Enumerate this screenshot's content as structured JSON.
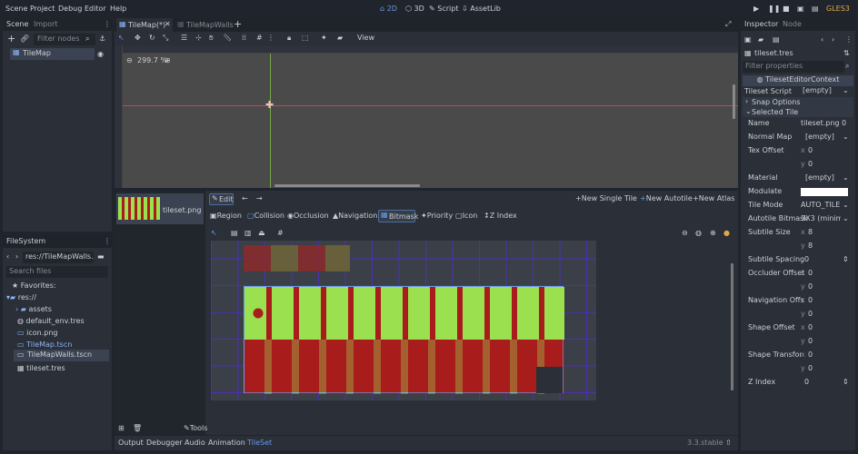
{
  "menu": {
    "scene": "Scene",
    "project": "Project",
    "debug": "Debug",
    "editor": "Editor",
    "help": "Help"
  },
  "workspaces": {
    "two_d": "2D",
    "three_d": "3D",
    "script": "Script",
    "assetlib": "AssetLib"
  },
  "renderer": "GLES3",
  "left_tabs": {
    "scene": "Scene",
    "import": "Import"
  },
  "scene_filter_placeholder": "Filter nodes",
  "scene_tree_root": "TileMap",
  "filesystem": {
    "title": "FileSystem",
    "path": "res://TileMapWalls.tsc",
    "search_placeholder": "Search files",
    "favorites": "Favorites:",
    "root": "res://",
    "items": [
      "assets",
      "default_env.tres",
      "icon.png",
      "TileMap.tscn",
      "TileMapWalls.tscn",
      "tileset.tres"
    ]
  },
  "doc_tabs": {
    "tab1": "TileMap(*)",
    "tab2": "TileMapWalls"
  },
  "view_menu": "View",
  "zoom": "299.7 %",
  "tileset_panel": {
    "texture_name": "tileset.png",
    "edit": "Edit",
    "new_single_tile": "New Single Tile",
    "new_autotile": "New Autotile",
    "new_atlas": "New Atlas",
    "modes": [
      "Region",
      "Collision",
      "Occlusion",
      "Navigation",
      "Bitmask",
      "Priority",
      "Icon",
      "Z Index"
    ],
    "tools": "Tools"
  },
  "bottom_tabs": [
    "Output",
    "Debugger",
    "Audio",
    "Animation",
    "TileSet"
  ],
  "version": "3.3.stable",
  "inspector": {
    "tabs": {
      "inspector": "Inspector",
      "node": "Node"
    },
    "resource": "tileset.tres",
    "filter_placeholder": "Filter properties",
    "context": "TilesetEditorContext",
    "tileset_script_label": "Tileset Script",
    "tileset_script_value": "[empty]",
    "snap_options": "Snap Options",
    "selected_tile": "Selected Tile",
    "props": {
      "name_label": "Name",
      "name_value": "tileset.png 0",
      "normal_map_label": "Normal Map",
      "normal_map_value": "[empty]",
      "tex_offset_label": "Tex Offset",
      "tex_offset_x": "0",
      "tex_offset_y": "0",
      "material_label": "Material",
      "material_value": "[empty]",
      "modulate_label": "Modulate",
      "tile_mode_label": "Tile Mode",
      "tile_mode_value": "AUTO_TILE",
      "autotile_bitmask_label": "Autotile Bitmask",
      "autotile_bitmask_value": "3X3 (minimal",
      "subtile_size_label": "Subtile Size",
      "subtile_size_x": "8",
      "subtile_size_y": "8",
      "subtile_spacing_label": "Subtile Spacing",
      "subtile_spacing_value": "0",
      "occluder_offset_label": "Occluder Offset",
      "occluder_offset_x": "0",
      "occluder_offset_y": "0",
      "navigation_offset_label": "Navigation Offs",
      "navigation_offset_x": "0",
      "navigation_offset_y": "0",
      "shape_offset_label": "Shape Offset",
      "shape_offset_x": "0",
      "shape_offset_y": "0",
      "shape_transform_label": "Shape Transfor",
      "shape_transform_x": "0",
      "shape_transform_y": "0",
      "z_index_label": "Z Index",
      "z_index_value": "0"
    },
    "axis_x": "x",
    "axis_y": "y"
  },
  "colors": {
    "accent": "#699ce8",
    "tile_red": "#a81c1c",
    "tile_green": "#9be04e",
    "bg": "#20252d"
  }
}
